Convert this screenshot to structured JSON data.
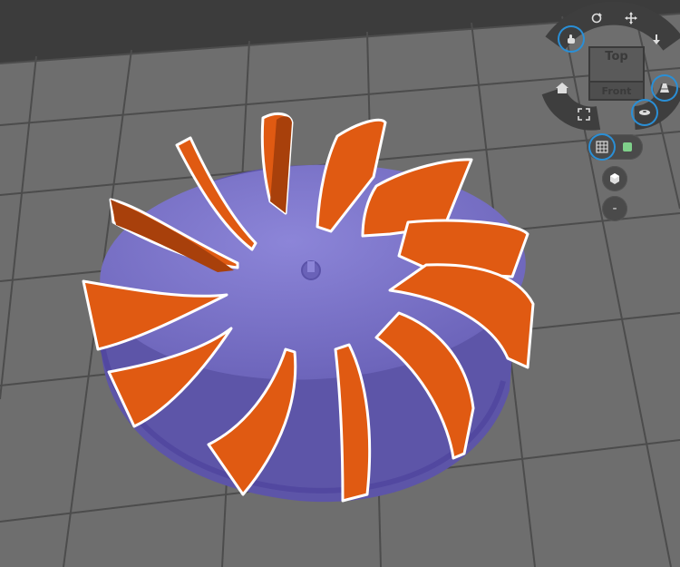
{
  "app": {
    "view_cube": {
      "top_label": "Top",
      "front_label": "Front"
    },
    "nav_controls": {
      "rotate_icon": "rotate-icon",
      "pan_icon": "move-arrows-icon",
      "touch_icon": "touch-hand-icon",
      "down_icon": "arrow-down-icon",
      "home_icon": "home-icon",
      "fit_icon": "fit-view-icon",
      "perspective_icon": "perspective-icon",
      "orbit_icon": "orbit-icon"
    },
    "side_tools": {
      "grid_toggle_icon": "grid-icon",
      "solid_toggle_icon": "solid-cube-icon",
      "material_icon": "material-icon",
      "zoom_out_label": "-"
    },
    "colors": {
      "background": "#6e6e6e",
      "grid_line": "#4a4a4a",
      "base": "#7a72c8",
      "blade": "#e05a12",
      "blade_dark": "#a8400b",
      "accent_ring": "#2a8fd6",
      "panel": "#3a3a3a"
    }
  }
}
